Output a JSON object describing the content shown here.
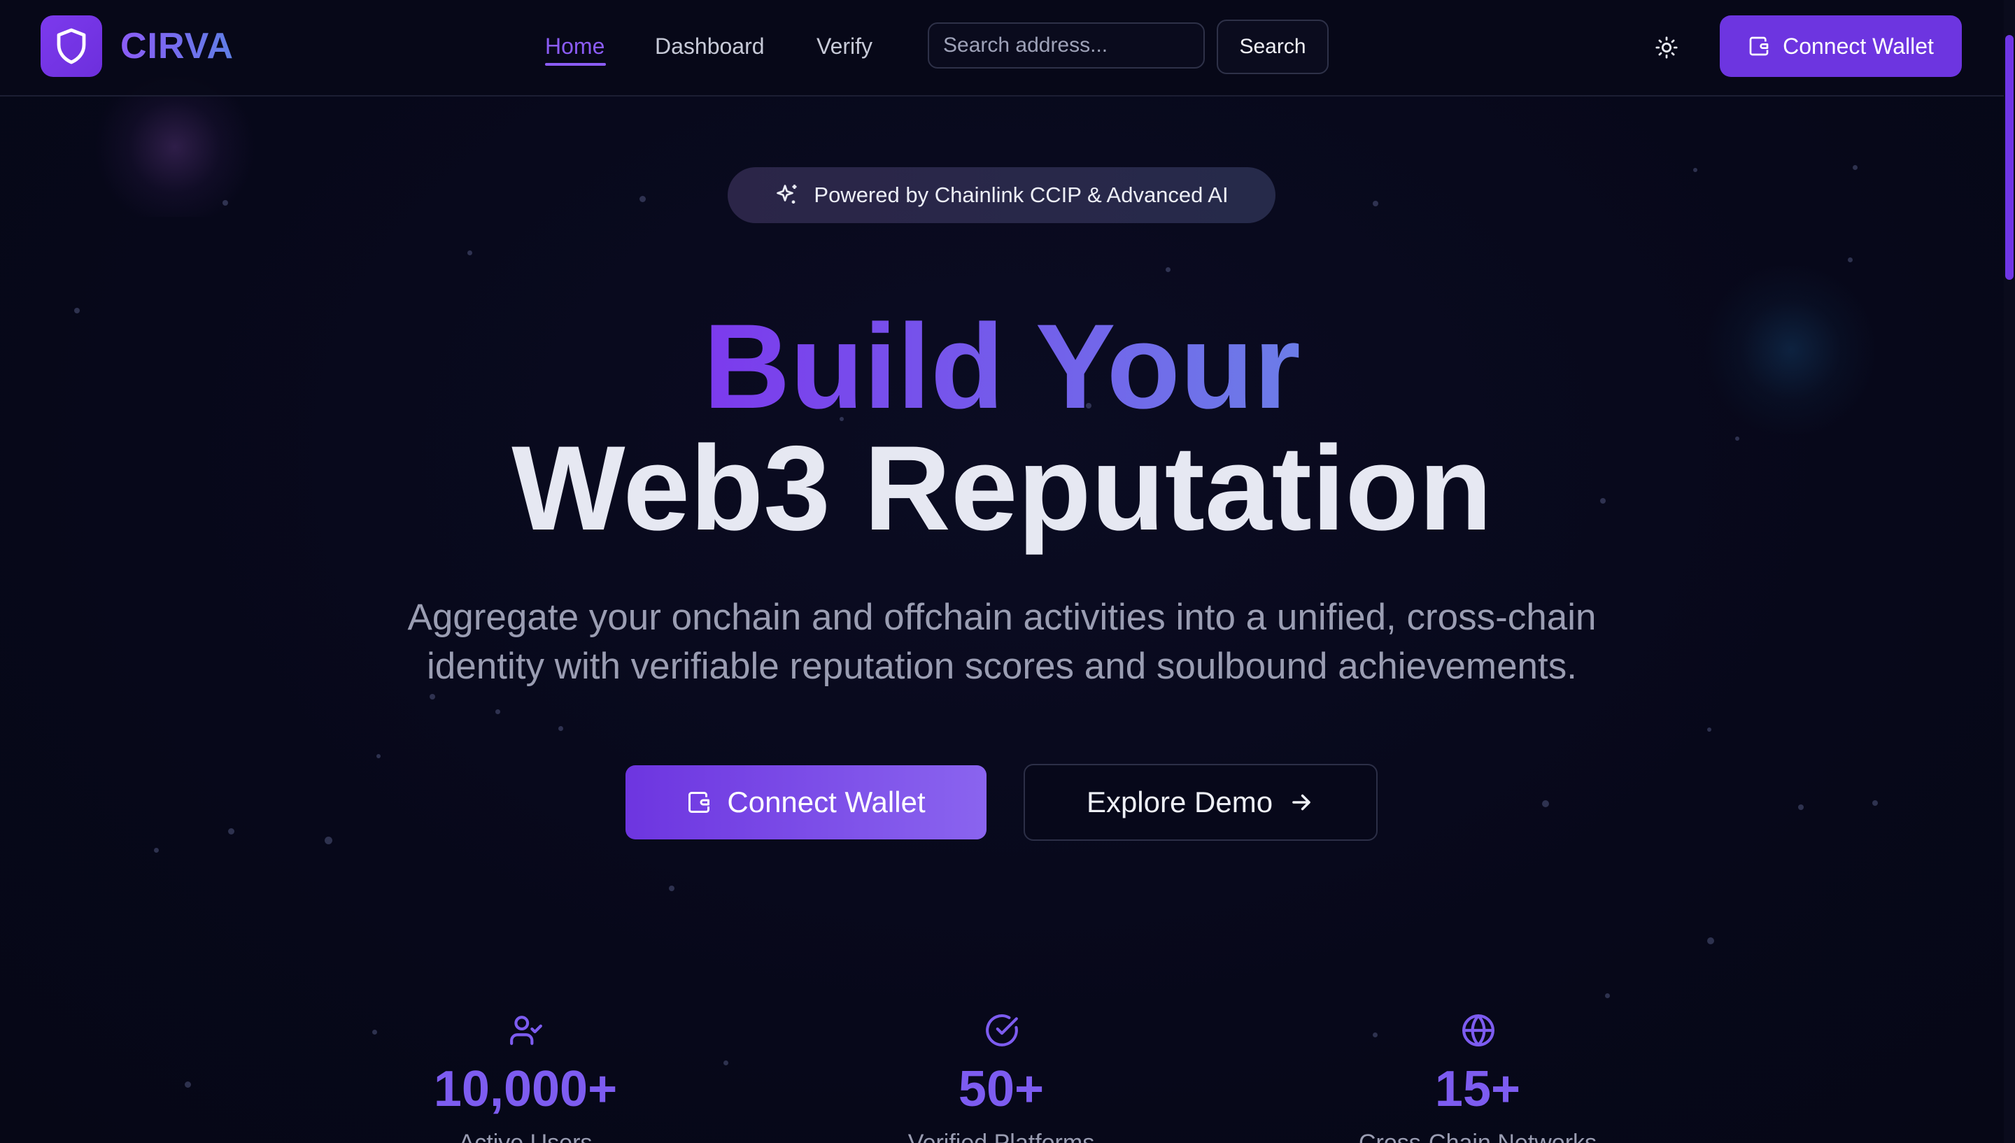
{
  "brand": {
    "name": "CIRVA"
  },
  "nav": {
    "home": "Home",
    "dashboard": "Dashboard",
    "verify": "Verify"
  },
  "search": {
    "placeholder": "Search address...",
    "button": "Search"
  },
  "header": {
    "connect_wallet": "Connect Wallet"
  },
  "hero": {
    "badge": "Powered by Chainlink CCIP & Advanced AI",
    "title_line1": "Build Your",
    "title_line2": "Web3 Reputation",
    "subtitle_line1": "Aggregate your onchain and offchain activities into a unified, cross-chain",
    "subtitle_line2": "identity with verifiable reputation scores and soulbound achievements.",
    "cta_primary": "Connect Wallet",
    "cta_secondary": "Explore Demo"
  },
  "stats": [
    {
      "value": "10,000+",
      "label": "Active Users",
      "icon": "user-check-icon"
    },
    {
      "value": "50+",
      "label": "Verified Platforms",
      "icon": "check-circle-icon"
    },
    {
      "value": "15+",
      "label": "Cross-Chain Networks",
      "icon": "globe-icon"
    }
  ],
  "colors": {
    "accent": "#7c3aed",
    "background": "#07081a",
    "text": "#e6e8f2",
    "muted": "#9a9db2"
  }
}
